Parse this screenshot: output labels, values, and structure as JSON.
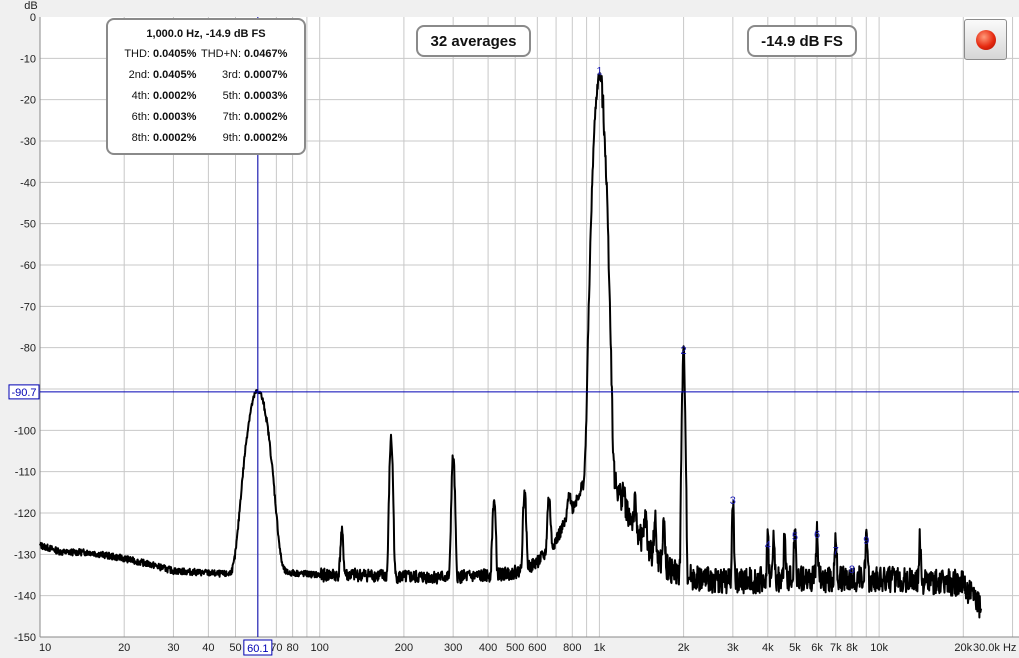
{
  "chart_data": {
    "type": "line",
    "title": "",
    "xlabel": "",
    "ylabel": "dB",
    "x_scale": "log",
    "xlim": [
      10,
      30000
    ],
    "ylim": [
      -150,
      0
    ],
    "grid": true,
    "x_ticks": [
      "10",
      "20",
      "30",
      "40",
      "50",
      "70",
      "80",
      "100",
      "200",
      "300",
      "400",
      "500",
      "600",
      "800",
      "1k",
      "2k",
      "3k",
      "4k",
      "5k",
      "6k",
      "7k",
      "8k",
      "10k",
      "20k",
      "30.0k Hz"
    ],
    "y_ticks": [
      "0",
      "-10",
      "-20",
      "-30",
      "-40",
      "-50",
      "-60",
      "-70",
      "-80",
      "-90",
      "-100",
      "-110",
      "-120",
      "-130",
      "-140",
      "-150"
    ],
    "cursor": {
      "x_readout": "60.1",
      "y_readout": "-90.7",
      "x": 60.1,
      "y": -90.7
    },
    "harmonic_markers": [
      {
        "label": "1",
        "x": 1000,
        "y": -14.9
      },
      {
        "label": "2",
        "x": 2000,
        "y": -82.5
      },
      {
        "label": "3",
        "x": 3000,
        "y": -118.8
      },
      {
        "label": "4",
        "x": 4000,
        "y": -129.5
      },
      {
        "label": "5",
        "x": 5000,
        "y": -127.5
      },
      {
        "label": "6",
        "x": 6000,
        "y": -127
      },
      {
        "label": "7",
        "x": 7000,
        "y": -131
      },
      {
        "label": "8",
        "x": 8000,
        "y": -135.5
      },
      {
        "label": "9",
        "x": 9000,
        "y": -128.5
      }
    ],
    "series": [
      {
        "color": "#000000",
        "floor": [
          [
            10,
            -127.8
          ],
          [
            12,
            -129.5
          ],
          [
            15,
            -129.5
          ],
          [
            18,
            -130.5
          ],
          [
            20,
            -131
          ],
          [
            25,
            -132.5
          ],
          [
            30,
            -134
          ],
          [
            40,
            -134.5
          ],
          [
            50,
            -135
          ],
          [
            57,
            -134.5
          ],
          [
            65,
            -135
          ],
          [
            80,
            -134.5
          ],
          [
            100,
            -135
          ],
          [
            150,
            -135
          ],
          [
            200,
            -135.5
          ],
          [
            300,
            -135.5
          ],
          [
            500,
            -135
          ],
          [
            700,
            -134.5
          ],
          [
            850,
            -132
          ],
          [
            1200,
            -134.5
          ],
          [
            2000,
            -136
          ],
          [
            3000,
            -136.5
          ],
          [
            5000,
            -136
          ],
          [
            10000,
            -136
          ],
          [
            15000,
            -136.5
          ],
          [
            20000,
            -137
          ],
          [
            22000,
            -141
          ],
          [
            23200,
            -143.5
          ]
        ],
        "peaks": [
          {
            "x": 60.1,
            "y": -90.7,
            "w": 0.035
          },
          {
            "x": 120,
            "y": -128,
            "w": 0.006
          },
          {
            "x": 180,
            "y": -102.5,
            "w": 0.006
          },
          {
            "x": 300,
            "y": -107,
            "w": 0.006
          },
          {
            "x": 420,
            "y": -118,
            "w": 0.006
          },
          {
            "x": 540,
            "y": -116.5,
            "w": 0.006
          },
          {
            "x": 660,
            "y": -118.5,
            "w": 0.006
          },
          {
            "x": 780,
            "y": -120.5,
            "w": 0.006
          },
          {
            "x": 900,
            "y": -119.5,
            "w": 0.005
          },
          {
            "x": 1000,
            "y": -14.9,
            "w": 0.015
          },
          {
            "x": 1100,
            "y": -122,
            "w": 0.005
          },
          {
            "x": 1220,
            "y": -124,
            "w": 0.005
          },
          {
            "x": 1340,
            "y": -125,
            "w": 0.005
          },
          {
            "x": 1460,
            "y": -126,
            "w": 0.005
          },
          {
            "x": 1580,
            "y": -126,
            "w": 0.005
          },
          {
            "x": 1700,
            "y": -127,
            "w": 0.005
          },
          {
            "x": 2000,
            "y": -82.5,
            "w": 0.005
          },
          {
            "x": 3000,
            "y": -118.8,
            "w": 0.004
          },
          {
            "x": 4000,
            "y": -129.5,
            "w": 0.004
          },
          {
            "x": 4200,
            "y": -130,
            "w": 0.004
          },
          {
            "x": 4600,
            "y": -129,
            "w": 0.004
          },
          {
            "x": 5000,
            "y": -127.5,
            "w": 0.004
          },
          {
            "x": 6000,
            "y": -127,
            "w": 0.004
          },
          {
            "x": 7000,
            "y": -131,
            "w": 0.004
          },
          {
            "x": 9000,
            "y": -128.5,
            "w": 0.004
          },
          {
            "x": 14000,
            "y": -130,
            "w": 0.004
          }
        ]
      }
    ]
  },
  "stats": {
    "header": "1,000.0 Hz, -14.9 dB FS",
    "rows": [
      [
        {
          "label": "THD:",
          "value": "0.0405%"
        },
        {
          "label": "THD+N:",
          "value": "0.0467%"
        }
      ],
      [
        {
          "label": "2nd:",
          "value": "0.0405%"
        },
        {
          "label": "3rd:",
          "value": "0.0007%"
        }
      ],
      [
        {
          "label": "4th:",
          "value": "0.0002%"
        },
        {
          "label": "5th:",
          "value": "0.0003%"
        }
      ],
      [
        {
          "label": "6th:",
          "value": "0.0003%"
        },
        {
          "label": "7th:",
          "value": "0.0002%"
        }
      ],
      [
        {
          "label": "8th:",
          "value": "0.0002%"
        },
        {
          "label": "9th:",
          "value": "0.0002%"
        }
      ]
    ]
  },
  "averages_label": "32 averages",
  "level_label": "-14.9 dB FS",
  "record_button": {
    "icon": "record-icon",
    "color": "#e62a10"
  },
  "colors": {
    "background": "#ffffff",
    "grid": "#c8c8c8",
    "trace": "#000000",
    "cursor": "#0000b4",
    "marker": "#1a1ab4",
    "panel": "#f0f0f0"
  }
}
